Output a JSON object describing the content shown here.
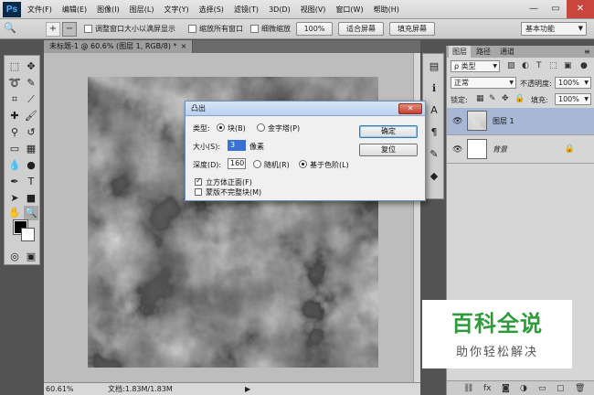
{
  "app": {
    "logo": "Ps",
    "menu": [
      "文件(F)",
      "编辑(E)",
      "图像(I)",
      "图层(L)",
      "文字(Y)",
      "选择(S)",
      "滤镜(T)",
      "3D(D)",
      "视图(V)",
      "窗口(W)",
      "帮助(H)"
    ],
    "window_controls": {
      "minimize": "—",
      "restore": "▭",
      "close": "✕"
    }
  },
  "options_bar": {
    "tool_glyph": "🔍",
    "resize_windows": "调整窗口大小以满屏显示",
    "zoom_all": "缩放所有窗口",
    "scrubby_zoom": "细微缩放",
    "btn_100": "100%",
    "btn_fit": "适合屏幕",
    "btn_fill": "填充屏幕",
    "workspace": "基本功能",
    "resize_windows_checked": false,
    "zoom_all_checked": false,
    "scrubby_zoom_checked": false
  },
  "document": {
    "tab": "未标题-1 @ 60.6% (图层 1, RGB/8) *",
    "tab_close": "×"
  },
  "status": {
    "zoom": "60.61%",
    "doc": "文档:1.83M/1.83M",
    "arrow": "▶"
  },
  "layers_panel": {
    "tabs": [
      "图层",
      "路径",
      "通道"
    ],
    "kind_label": "ρ 类型",
    "blend_mode": "正常",
    "opacity_label": "不透明度:",
    "opacity_value": "100%",
    "lock_label": "锁定:",
    "fill_label": "填充:",
    "fill_value": "100%",
    "layers": [
      {
        "name": "图层 1",
        "selected": true,
        "locked": false
      },
      {
        "name": "背景",
        "selected": false,
        "locked": true
      }
    ]
  },
  "dialog": {
    "title": "凸出",
    "close": "✕",
    "type_label": "类型:",
    "type_block": "块(B)",
    "type_pyramid": "金字塔(P)",
    "size_label": "大小(S):",
    "size_value": "3",
    "size_unit": "像素",
    "depth_label": "深度(D):",
    "depth_value": "160",
    "random": "随机(R)",
    "level_based": "基于色阶(L)",
    "solid_front": "立方体正面(F)",
    "mask_incomplete": "蒙版不完整块(M)",
    "ok": "确定",
    "reset": "复位",
    "type_selected": "block",
    "depth_selected": "level",
    "solid_front_checked": true,
    "mask_incomplete_checked": false
  },
  "watermark": {
    "title": "百科全说",
    "subtitle": "助你轻松解决"
  }
}
